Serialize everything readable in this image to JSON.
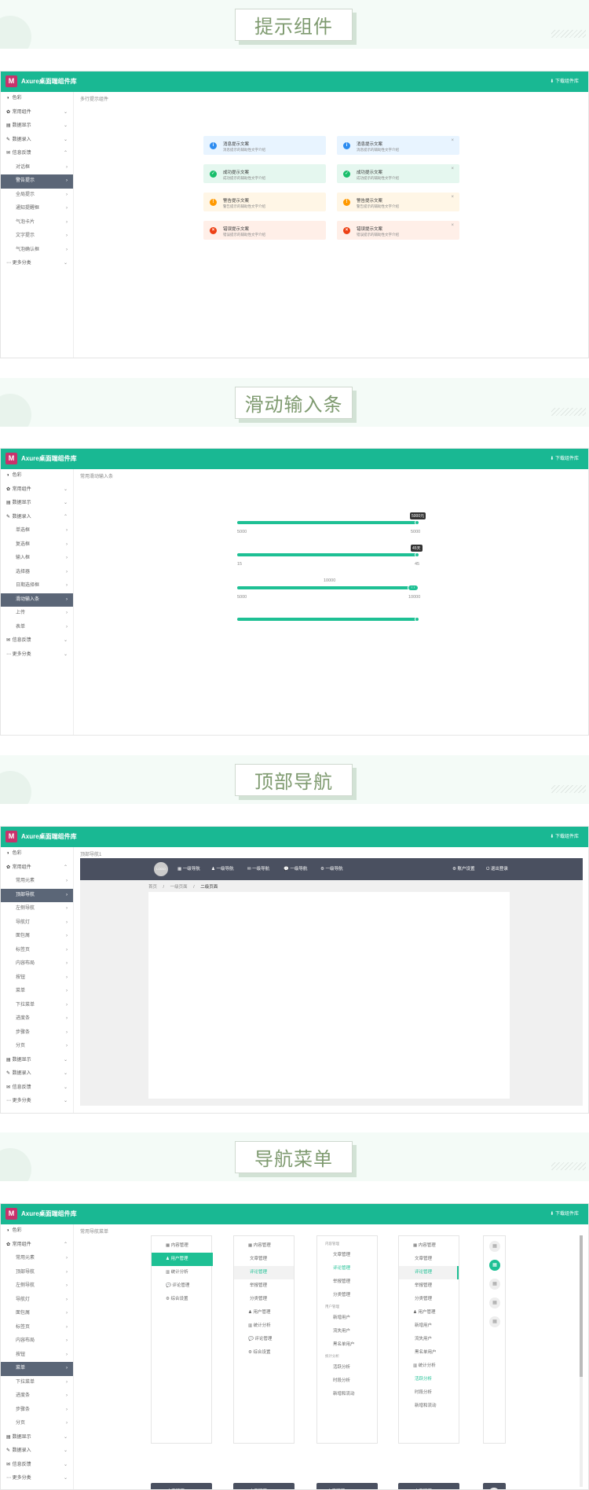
{
  "app": {
    "brand": "Axure桌面端组件库",
    "download": "下载组件库"
  },
  "s1": {
    "title": "提示组件",
    "caption": "多行提示组件",
    "menu": [
      {
        "icon": "◑",
        "label": "色彩",
        "arrow": ""
      },
      {
        "icon": "✿",
        "label": "常用组件",
        "arrow": "⌄"
      },
      {
        "icon": "▤",
        "label": "数据显示",
        "arrow": "⌄"
      },
      {
        "icon": "✎",
        "label": "数据录入",
        "arrow": "⌄"
      },
      {
        "icon": "✉",
        "label": "信息反馈",
        "arrow": "⌃"
      },
      {
        "icon": "",
        "label": "对话框",
        "arrow": "›",
        "sub": true
      },
      {
        "icon": "",
        "label": "警告提示",
        "arrow": "›",
        "sub": true,
        "active": true
      },
      {
        "icon": "",
        "label": "全局提示",
        "arrow": "›",
        "sub": true
      },
      {
        "icon": "",
        "label": "通知提醒框",
        "arrow": "›",
        "sub": true
      },
      {
        "icon": "",
        "label": "气泡卡片",
        "arrow": "›",
        "sub": true
      },
      {
        "icon": "",
        "label": "文字提示",
        "arrow": "›",
        "sub": true
      },
      {
        "icon": "",
        "label": "气泡确认框",
        "arrow": "›",
        "sub": true
      },
      {
        "icon": "⋯",
        "label": "更多分类",
        "arrow": "⌄"
      }
    ],
    "alerts": [
      {
        "kind": "info",
        "title": "消息提示文案",
        "desc": "消息提示的辅助性文字介绍",
        "icon": "i"
      },
      {
        "kind": "info",
        "title": "消息提示文案",
        "desc": "消息提示的辅助性文字介绍",
        "icon": "i",
        "close": "×"
      },
      {
        "kind": "success",
        "title": "成功提示文案",
        "desc": "成功提示的辅助性文字介绍",
        "icon": "✓"
      },
      {
        "kind": "success",
        "title": "成功提示文案",
        "desc": "成功提示的辅助性文字介绍",
        "icon": "✓",
        "close": "×"
      },
      {
        "kind": "warning",
        "title": "警告提示文案",
        "desc": "警告提示的辅助性文字介绍",
        "icon": "!"
      },
      {
        "kind": "warning",
        "title": "警告提示文案",
        "desc": "警告提示的辅助性文字介绍",
        "icon": "!",
        "close": "×"
      },
      {
        "kind": "error",
        "title": "错误提示文案",
        "desc": "错误提示的辅助性文字介绍",
        "icon": "×"
      },
      {
        "kind": "error",
        "title": "错误提示文案",
        "desc": "错误提示的辅助性文字介绍",
        "icon": "×",
        "close": "×"
      }
    ]
  },
  "s2": {
    "title": "滑动输入条",
    "caption": "常用滑动输入条",
    "menu": [
      {
        "icon": "◑",
        "label": "色彩",
        "arrow": ""
      },
      {
        "icon": "✿",
        "label": "常用组件",
        "arrow": "⌄"
      },
      {
        "icon": "▤",
        "label": "数据显示",
        "arrow": "⌄"
      },
      {
        "icon": "✎",
        "label": "数据录入",
        "arrow": "⌃"
      },
      {
        "icon": "",
        "label": "单选框",
        "arrow": "›",
        "sub": true
      },
      {
        "icon": "",
        "label": "复选框",
        "arrow": "›",
        "sub": true
      },
      {
        "icon": "",
        "label": "输入框",
        "arrow": "›",
        "sub": true
      },
      {
        "icon": "",
        "label": "选择器",
        "arrow": "›",
        "sub": true
      },
      {
        "icon": "",
        "label": "日期选择框",
        "arrow": "›",
        "sub": true
      },
      {
        "icon": "",
        "label": "滑动输入条",
        "arrow": "›",
        "sub": true,
        "active": true
      },
      {
        "icon": "",
        "label": "上传",
        "arrow": "›",
        "sub": true
      },
      {
        "icon": "",
        "label": "表单",
        "arrow": "›",
        "sub": true
      },
      {
        "icon": "✉",
        "label": "信息反馈",
        "arrow": "⌄"
      },
      {
        "icon": "⋯",
        "label": "更多分类",
        "arrow": "⌄"
      }
    ],
    "sliders": {
      "a_tip": "5000元",
      "a_min": "5000",
      "a_max": "5000",
      "b_tip": "45天",
      "b_min": "15",
      "b_max": "45",
      "c_top": "10000",
      "c_min": "5000",
      "c_max": "10000"
    }
  },
  "s3": {
    "title": "顶部导航",
    "caption": "顶部导航1",
    "menu": [
      {
        "icon": "◑",
        "label": "色彩",
        "arrow": ""
      },
      {
        "icon": "✿",
        "label": "常用组件",
        "arrow": "⌃"
      },
      {
        "icon": "",
        "label": "常用元素",
        "arrow": "›",
        "sub": true
      },
      {
        "icon": "",
        "label": "顶部导航",
        "arrow": "›",
        "sub": true,
        "active": true
      },
      {
        "icon": "",
        "label": "左侧导航",
        "arrow": "›",
        "sub": true
      },
      {
        "icon": "",
        "label": "导航灯",
        "arrow": "›",
        "sub": true
      },
      {
        "icon": "",
        "label": "面包屑",
        "arrow": "›",
        "sub": true
      },
      {
        "icon": "",
        "label": "标签页",
        "arrow": "›",
        "sub": true
      },
      {
        "icon": "",
        "label": "内容布局",
        "arrow": "›",
        "sub": true
      },
      {
        "icon": "",
        "label": "按钮",
        "arrow": "›",
        "sub": true
      },
      {
        "icon": "",
        "label": "菜单",
        "arrow": "›",
        "sub": true
      },
      {
        "icon": "",
        "label": "下拉菜单",
        "arrow": "›",
        "sub": true
      },
      {
        "icon": "",
        "label": "进度条",
        "arrow": "›",
        "sub": true
      },
      {
        "icon": "",
        "label": "步骤条",
        "arrow": "›",
        "sub": true
      },
      {
        "icon": "",
        "label": "分页",
        "arrow": "›",
        "sub": true
      },
      {
        "icon": "▤",
        "label": "数据显示",
        "arrow": "⌄"
      },
      {
        "icon": "✎",
        "label": "数据录入",
        "arrow": "⌄"
      },
      {
        "icon": "✉",
        "label": "信息反馈",
        "arrow": "⌄"
      },
      {
        "icon": "⋯",
        "label": "更多分类",
        "arrow": "⌄"
      }
    ],
    "logo": "LOGO",
    "nav": [
      "▦ 一级导航",
      "♟ 一级导航",
      "✉ 一级导航",
      "💬 一级导航",
      "⚙ 一级导航"
    ],
    "right": [
      "⚙ 账户设置",
      "⏻ 退出登录"
    ],
    "crumbs": [
      "首页",
      "/",
      "一级页面",
      "/",
      "二级页面"
    ]
  },
  "s4": {
    "title": "导航菜单",
    "caption": "常用导航菜单",
    "menu": [
      {
        "icon": "◑",
        "label": "色彩",
        "arrow": ""
      },
      {
        "icon": "✿",
        "label": "常用组件",
        "arrow": "⌃"
      },
      {
        "icon": "",
        "label": "常用元素",
        "arrow": "›",
        "sub": true
      },
      {
        "icon": "",
        "label": "顶部导航",
        "arrow": "›",
        "sub": true
      },
      {
        "icon": "",
        "label": "左侧导航",
        "arrow": "›",
        "sub": true
      },
      {
        "icon": "",
        "label": "导航灯",
        "arrow": "›",
        "sub": true
      },
      {
        "icon": "",
        "label": "面包屑",
        "arrow": "›",
        "sub": true
      },
      {
        "icon": "",
        "label": "标签页",
        "arrow": "›",
        "sub": true
      },
      {
        "icon": "",
        "label": "内容布局",
        "arrow": "›",
        "sub": true
      },
      {
        "icon": "",
        "label": "按钮",
        "arrow": "›",
        "sub": true
      },
      {
        "icon": "",
        "label": "菜单",
        "arrow": "›",
        "sub": true,
        "active": true
      },
      {
        "icon": "",
        "label": "下拉菜单",
        "arrow": "›",
        "sub": true
      },
      {
        "icon": "",
        "label": "进度条",
        "arrow": "›",
        "sub": true
      },
      {
        "icon": "",
        "label": "步骤条",
        "arrow": "›",
        "sub": true
      },
      {
        "icon": "",
        "label": "分页",
        "arrow": "›",
        "sub": true
      },
      {
        "icon": "▤",
        "label": "数据显示",
        "arrow": "⌄"
      },
      {
        "icon": "✎",
        "label": "数据录入",
        "arrow": "⌄"
      },
      {
        "icon": "✉",
        "label": "信息反馈",
        "arrow": "⌄"
      },
      {
        "icon": "⋯",
        "label": "更多分类",
        "arrow": "⌄"
      }
    ],
    "panels": [
      {
        "items": [
          {
            "t": "▦ 内容管理"
          },
          {
            "t": "♟ 用户管理",
            "hl": "solid"
          },
          {
            "t": "▥ 统计分析"
          },
          {
            "t": "💬 评论管理"
          },
          {
            "t": "⚙ 综合设置"
          }
        ]
      },
      {
        "items": [
          {
            "t": "▦ 内容管理"
          },
          {
            "t": "文章管理",
            "indent": true
          },
          {
            "t": "评论管理",
            "indent": true,
            "hl": "grey"
          },
          {
            "t": "举报管理",
            "indent": true
          },
          {
            "t": "分类管理",
            "indent": true
          },
          {
            "t": "♟ 用户管理"
          },
          {
            "t": "▥ 统计分析"
          },
          {
            "t": "💬 评论管理"
          },
          {
            "t": "⚙ 综合设置"
          }
        ]
      },
      {
        "items": [
          {
            "t": "内容管理",
            "small": true
          },
          {
            "t": "文章管理",
            "indent": true
          },
          {
            "t": "评论管理",
            "indent": true,
            "hl": "green"
          },
          {
            "t": "举报管理",
            "indent": true
          },
          {
            "t": "分类管理",
            "indent": true
          },
          {
            "t": "用户管理",
            "small": true
          },
          {
            "t": "新增用户",
            "indent": true
          },
          {
            "t": "流失用户",
            "indent": true
          },
          {
            "t": "黑名单用户",
            "indent": true
          },
          {
            "t": "统计分析",
            "small": true
          },
          {
            "t": "活跃分析",
            "indent": true
          },
          {
            "t": "时段分析",
            "indent": true
          },
          {
            "t": "新增和流动",
            "indent": true
          }
        ]
      },
      {
        "items": [
          {
            "t": "▦ 内容管理"
          },
          {
            "t": "文章管理",
            "indent": true
          },
          {
            "t": "评论管理",
            "indent": true,
            "hl": "bar"
          },
          {
            "t": "举报管理",
            "indent": true
          },
          {
            "t": "分类管理",
            "indent": true
          },
          {
            "t": "♟ 用户管理"
          },
          {
            "t": "新增用户",
            "indent": true
          },
          {
            "t": "流失用户",
            "indent": true
          },
          {
            "t": "黑名单用户",
            "indent": true
          },
          {
            "t": "▥ 统计分析"
          },
          {
            "t": "活跃分析",
            "indent": true,
            "hl": "green"
          },
          {
            "t": "时段分析",
            "indent": true
          },
          {
            "t": "新增和流动",
            "indent": true
          }
        ]
      }
    ],
    "dark": [
      {
        "a": "▦ 内容管理",
        "b": "♟ 用户管理"
      },
      {
        "a": "▦ 内容管理",
        "b": "文章管理"
      },
      {
        "a": "内容管理",
        "b": "文章管理"
      },
      {
        "a": "▦ 内容管理",
        "b": "文章管理"
      }
    ]
  }
}
